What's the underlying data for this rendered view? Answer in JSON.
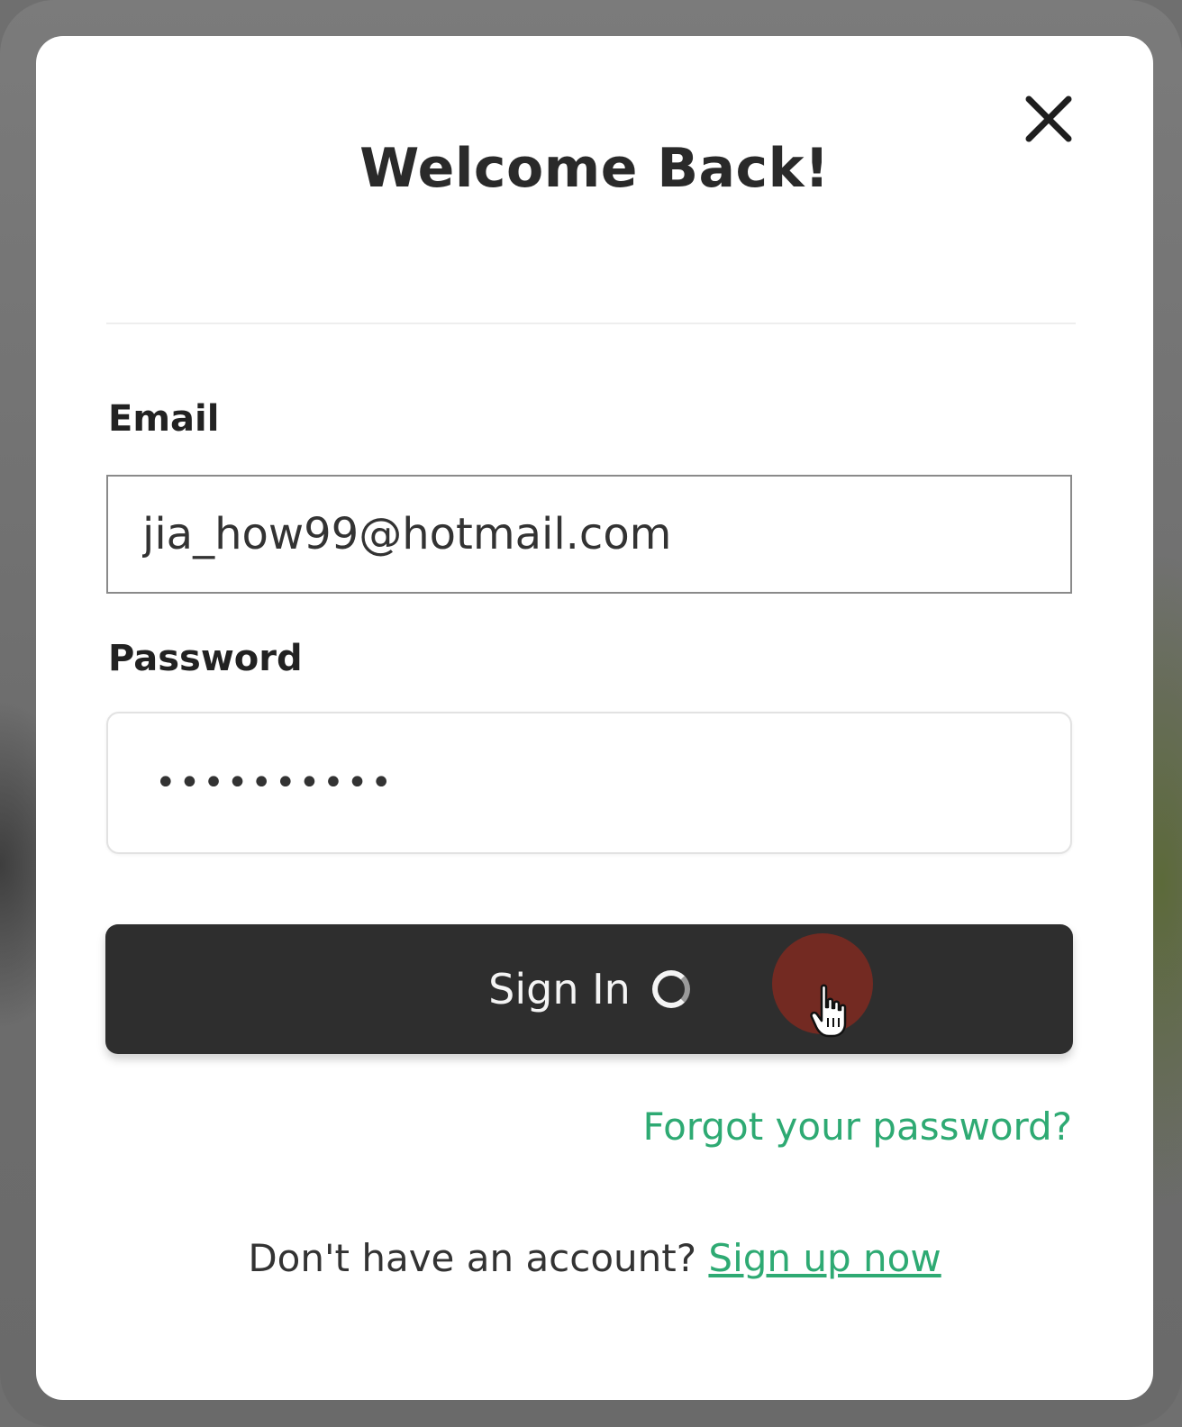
{
  "modal": {
    "title": "Welcome Back!",
    "close_icon": "close-icon"
  },
  "form": {
    "email_label": "Email",
    "email_value": "jia_how99@hotmail.com",
    "password_label": "Password",
    "password_value": "••••••••••",
    "submit_label": "Sign In",
    "submit_icon": "loading-spinner-icon"
  },
  "links": {
    "forgot_password": "Forgot your password?",
    "signup_prompt": "Don't have an account?",
    "signup_link": "Sign up now"
  },
  "colors": {
    "accent_green": "#2eaa73",
    "button_dark": "#2e2e2e",
    "click_indicator": "#7a2a22"
  },
  "cursor": {
    "type": "hand-pointer-icon"
  }
}
